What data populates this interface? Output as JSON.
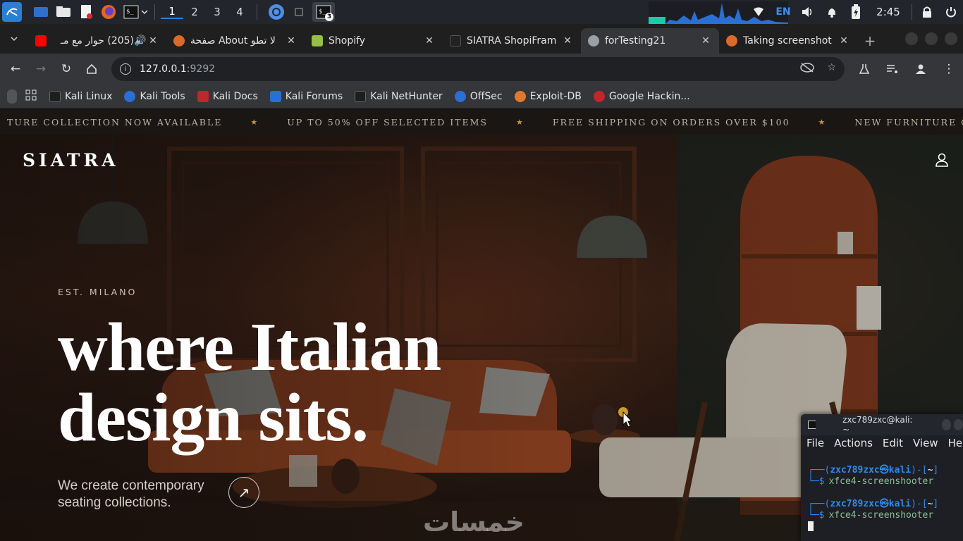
{
  "panel": {
    "workspaces": [
      "1",
      "2",
      "3",
      "4"
    ],
    "active_workspace": "1",
    "terminal_badge": "3",
    "language": "EN",
    "clock": "2:45"
  },
  "browser": {
    "tabs": [
      {
        "title": "(205) حوار مع مـ",
        "favicon_color": "#ff0000"
      },
      {
        "title": "صفحة About لا تطو",
        "favicon_color": "#d96b2b"
      },
      {
        "title": "Shopify",
        "favicon_color": "#95bf47"
      },
      {
        "title": "SIATRA ShopiFram",
        "favicon_color": "#222222"
      },
      {
        "title": "forTesting21",
        "favicon_color": "#9aa0a6"
      },
      {
        "title": "Taking screenshot",
        "favicon_color": "#d96b2b"
      }
    ],
    "active_tab": 4,
    "url_host": "127.0.0.1",
    "url_port": ":9292",
    "bookmarks": [
      {
        "label": "Kali Linux",
        "color": "#1e1e1e"
      },
      {
        "label": "Kali Tools",
        "color": "#2a6fd3"
      },
      {
        "label": "Kali Docs",
        "color": "#c0262b"
      },
      {
        "label": "Kali Forums",
        "color": "#2a6fd3"
      },
      {
        "label": "Kali NetHunter",
        "color": "#1e1e1e"
      },
      {
        "label": "OffSec",
        "color": "#2a6fd3"
      },
      {
        "label": "Exploit-DB",
        "color": "#e07a2a"
      },
      {
        "label": "Google Hackin...",
        "color": "#c0262b"
      }
    ]
  },
  "site": {
    "announcements": [
      "TURE COLLECTION NOW AVAILABLE",
      "UP TO 50% OFF SELECTED ITEMS",
      "FREE SHIPPING ON ORDERS OVER $100",
      "NEW FURNITURE COLLECTION NOW AVA"
    ],
    "announcement_separator": "★",
    "logo": "SIATRA",
    "eyebrow": "EST. MILANO",
    "headline_line1": "where Italian",
    "headline_line2": "design sits.",
    "subtitle": "We create contemporary seating collections.",
    "arrow_glyph": "↗",
    "watermark": "خمسات",
    "accent_color": "#c8913d"
  },
  "terminal": {
    "title": "zxc789zxc@kali: ~",
    "menu": [
      "File",
      "Actions",
      "Edit",
      "View",
      "Help"
    ],
    "user": "zxc789zxc",
    "host": "kali",
    "cwd": "~",
    "commands": [
      "xfce4-screenshooter",
      "xfce4-screenshooter"
    ]
  }
}
